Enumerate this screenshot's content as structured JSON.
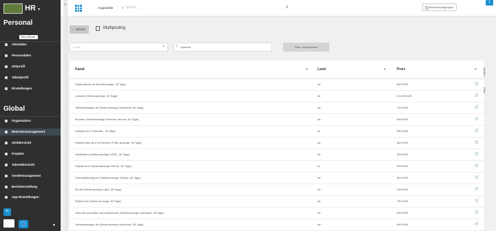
{
  "sidebar": {
    "brand": "HR",
    "section_personal": "Personal",
    "user_name": "Tina Zöhner",
    "personal_items": [
      {
        "label": "Abmelden"
      },
      {
        "label": "Personalakte"
      },
      {
        "label": "Zeitprofil"
      },
      {
        "label": "Talentprofil"
      },
      {
        "label": "Einstellungen"
      }
    ],
    "section_global": "Global",
    "global_items": [
      {
        "label": "Organisation"
      },
      {
        "label": "Bewerbermanagement"
      },
      {
        "label": "Zeitübersicht"
      },
      {
        "label": "Projekte"
      },
      {
        "label": "Talentübersicht"
      },
      {
        "label": "Gerätemanagement"
      },
      {
        "label": "Berichterstellung"
      },
      {
        "label": "App Einstellungen"
      }
    ],
    "edit_icon": "✎",
    "circle_icon": "◯"
  },
  "header": {
    "select_label": "Angestellte",
    "search_placeholder": "Suche...",
    "notify_label": "Benachrichtigungen",
    "badge_count": "7"
  },
  "page": {
    "back_label": "Zurück",
    "title": "Multiposting",
    "search_placeholder": "Suche",
    "language_label": "Sprache",
    "reset_label": "Filter zurücksetzen"
  },
  "table": {
    "columns": [
      "Kanal",
      "Land",
      "Preis"
    ],
    "rows": [
      {
        "kanal": "Süddeutsche.de (Einzelanzeige, 28 Tage)",
        "land": "de",
        "preis": "650 EUR"
      },
      {
        "kanal": "LinkedIn (Stellenanzeige, 30 Tage)",
        "land": "de",
        "preis": "211.95 EUR"
      },
      {
        "kanal": "Stellenanzeigen.de (Stellenanzeige Individuell, 60 Tage)",
        "land": "de",
        "preis": "745 EUR"
      },
      {
        "kanal": "Monster (Stellenanzeige Premium Service, 60 Tage)",
        "land": "de",
        "preis": "699 EUR"
      },
      {
        "kanal": "Hoteljob.ch (2 Inserate , 30 Tage)",
        "land": "ch",
        "preis": "650 EUR"
      },
      {
        "kanal": "HotelierJobs.de (Full-Service HTML-Anzeige, 56 Tage)",
        "land": "de",
        "preis": "489 EUR"
      },
      {
        "kanal": "JobMedieur (Stellenanzeige HTML, 56 Tage)",
        "land": "de",
        "preis": "399 EUR"
      },
      {
        "kanal": "Stepstone.nl (Stellenanzeige SM.NL, 60 Tage)",
        "land": "nl",
        "preis": "599 EUR"
      },
      {
        "kanal": "OnlineMarketing.de (Stellenanzeige Classic, 60 Tage)",
        "land": "de",
        "preis": "594 EUR"
      },
      {
        "kanal": "t3n.de (Stellenanzeige Light, 30 Tage)",
        "land": "de",
        "preis": "249 EUR"
      },
      {
        "kanal": "FAZjob.net (Online-Anzeige, 60 Tage)",
        "land": "de",
        "preis": "750 EUR"
      },
      {
        "kanal": "Jobs der (normalis Canonbuiddr.de) (Stellenanzeige Individuell, 38 Tage)",
        "land": "de",
        "preis": "499 EUR"
      },
      {
        "kanal": "Stellenanzeigen.de (Stellenanzeige Individuell, 30 Tage)",
        "land": "de",
        "preis": "690 EUR"
      }
    ]
  },
  "side_tabs": {
    "filter_label": "Spalten",
    "filter2_label": "Filter"
  },
  "colors": {
    "accent": "#1d8fd0",
    "sidebar": "#2f2f2f"
  },
  "icons": [
    "apps-grid-icon",
    "search-icon",
    "cart-icon",
    "back-arrow-icon",
    "multiposting-icon",
    "edit-icon",
    "message-icon"
  ]
}
